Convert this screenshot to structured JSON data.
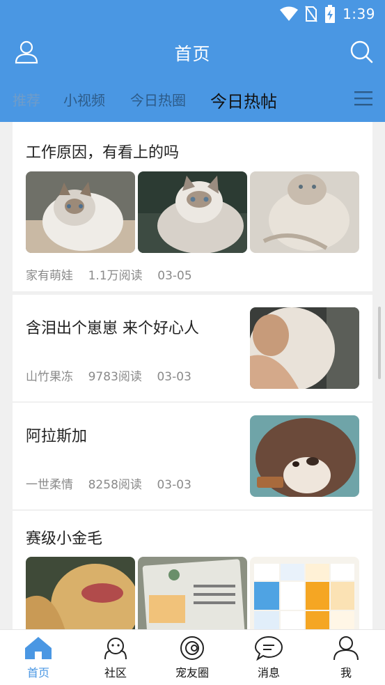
{
  "status": {
    "time": "1:39"
  },
  "header": {
    "title": "首页"
  },
  "tabs": [
    {
      "label": "推荐"
    },
    {
      "label": "小视频"
    },
    {
      "label": "今日热圈"
    },
    {
      "label": "今日热帖"
    }
  ],
  "posts": [
    {
      "title": "工作原因，有看上的吗",
      "meta": "家有萌娃    1.1万阅读    03-05"
    },
    {
      "title": "含泪出个崽崽 来个好心人",
      "meta": "山竹果冻    9783阅读    03-03"
    },
    {
      "title": "阿拉斯加",
      "meta": "一世柔情    8258阅读    03-03"
    },
    {
      "title": "赛级小金毛"
    }
  ],
  "bottom_nav": [
    {
      "label": "首页"
    },
    {
      "label": "社区"
    },
    {
      "label": "宠友圈"
    },
    {
      "label": "消息"
    },
    {
      "label": "我"
    }
  ],
  "colors": {
    "primary": "#4a97e3",
    "background": "#f0f0f0",
    "card": "#ffffff",
    "meta_text": "#8a8a8a"
  }
}
